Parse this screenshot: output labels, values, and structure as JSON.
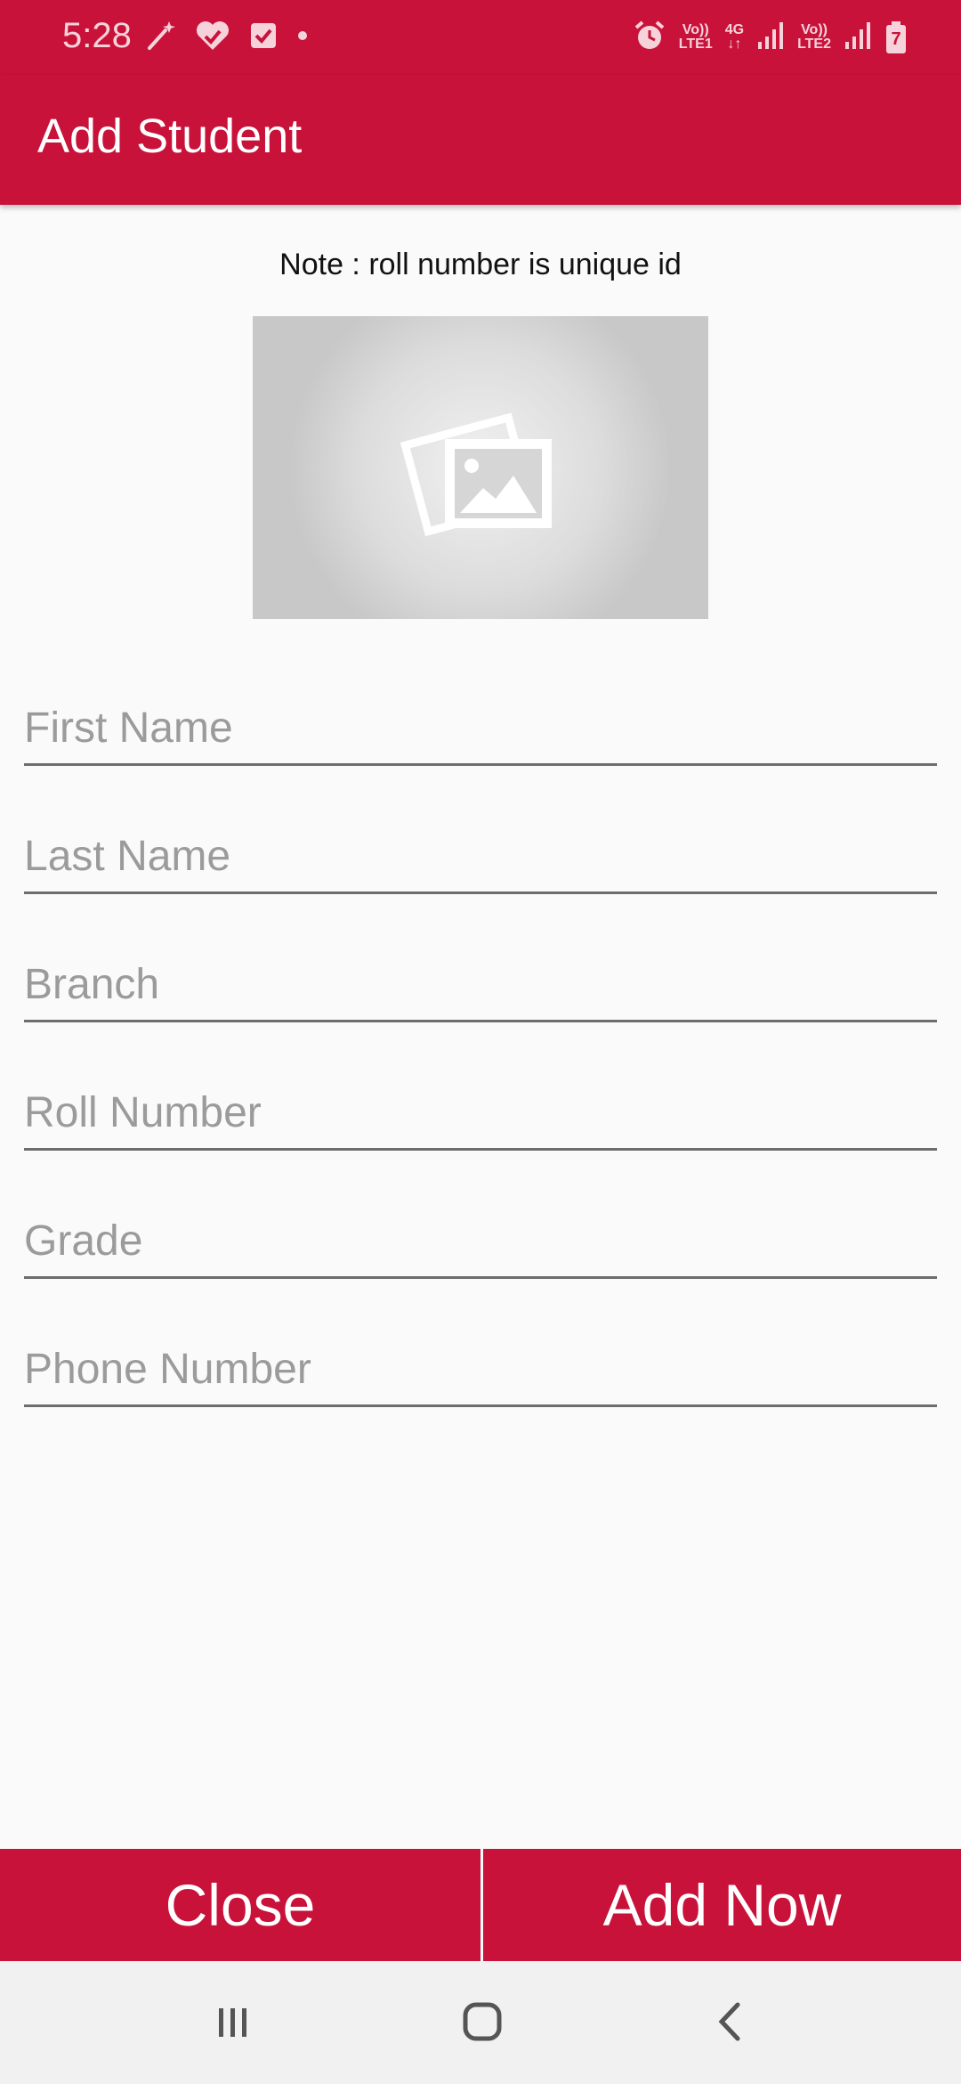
{
  "status_bar": {
    "time": "5:28",
    "left_icons": [
      "magic-wand-icon",
      "heart-check-icon",
      "checkbox-icon",
      "dot-icon"
    ],
    "right_icons": [
      "alarm-icon",
      "volte-lte1-icon",
      "4g-data-icon",
      "signal-icon",
      "volte-lte2-icon",
      "signal-icon",
      "battery-charging-icon"
    ],
    "lte1_top": "Vo))",
    "lte1_bottom": "LTE1",
    "data_label": "4G",
    "lte2_top": "Vo))",
    "lte2_bottom": "LTE2",
    "battery_level": "7"
  },
  "app_bar": {
    "title": "Add Student"
  },
  "form": {
    "note": "Note : roll number is unique id",
    "image_icon": "image-gallery-icon",
    "fields": [
      {
        "name": "first-name",
        "placeholder": "First Name",
        "value": ""
      },
      {
        "name": "last-name",
        "placeholder": "Last Name",
        "value": ""
      },
      {
        "name": "branch",
        "placeholder": "Branch",
        "value": ""
      },
      {
        "name": "roll-number",
        "placeholder": "Roll Number",
        "value": ""
      },
      {
        "name": "grade",
        "placeholder": "Grade",
        "value": ""
      },
      {
        "name": "phone-number",
        "placeholder": "Phone Number",
        "value": ""
      }
    ]
  },
  "actions": {
    "close_label": "Close",
    "add_label": "Add Now"
  },
  "nav_bar": {
    "icons": [
      "recents-icon",
      "home-icon",
      "back-icon"
    ]
  },
  "colors": {
    "primary": "#c8123a",
    "background": "#fafafa",
    "nav_background": "#f1f1f1"
  }
}
